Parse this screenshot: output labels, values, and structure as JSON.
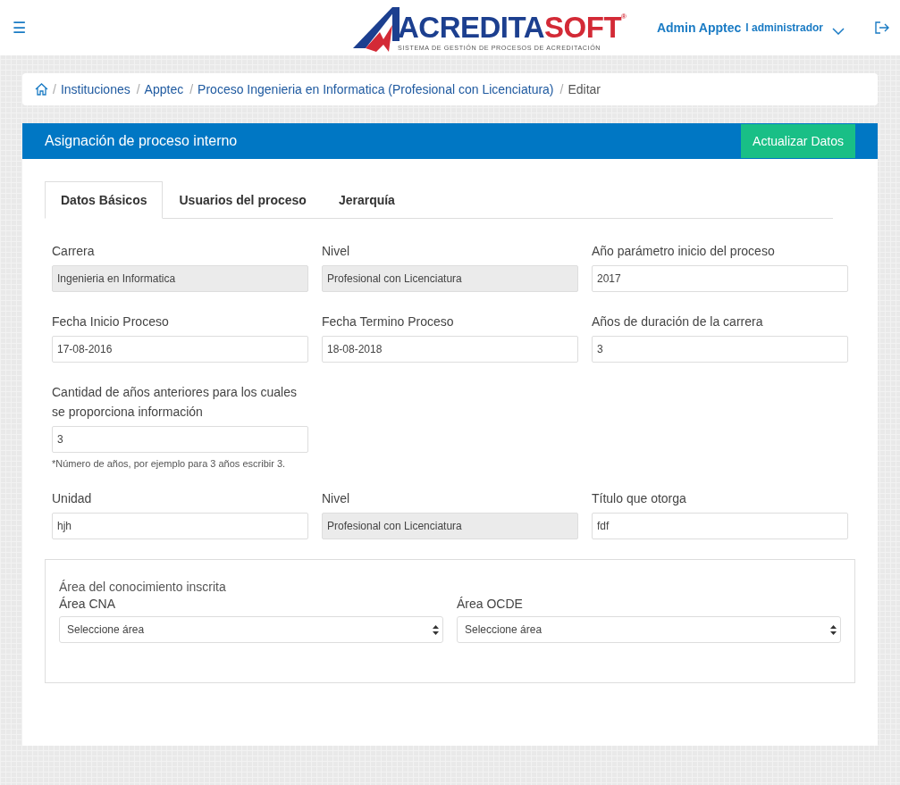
{
  "header": {
    "menu_icon": "☰",
    "logo": {
      "part_1": "ACREDITA",
      "part_2": "SOFT",
      "registered": "®",
      "tagline": "SISTEMA DE GESTIÓN DE PROCESOS DE ACREDITACIÓN"
    },
    "user": {
      "name": "Admin Apptec",
      "role": "l administrador"
    }
  },
  "breadcrumb": [
    {
      "separator": "/",
      "label": "Instituciones",
      "link": true
    },
    {
      "separator": "/",
      "label": "Apptec",
      "link": true
    },
    {
      "separator": "/",
      "label": "Proceso Ingenieria en Informatica (Profesional con Licenciatura)",
      "link": true
    },
    {
      "separator": "/",
      "label": "Editar",
      "link": false
    }
  ],
  "panel": {
    "title": "Asignación de proceso interno",
    "button": "Actualizar Datos"
  },
  "tabs": [
    {
      "label": "Datos Básicos",
      "selected": true
    },
    {
      "label": "Usuarios del proceso",
      "selected": false
    },
    {
      "label": "Jerarquía",
      "selected": false
    }
  ],
  "rows": [
    [
      {
        "label": "Carrera",
        "value": "Ingenieria en Informatica",
        "disabled": true
      },
      {
        "label": "Nivel",
        "value": "Profesional con Licenciatura",
        "disabled": true
      },
      {
        "label": "Año parámetro inicio del proceso",
        "value": "2017",
        "disabled": false
      }
    ],
    [
      {
        "label": "Fecha Inicio Proceso",
        "value": "17-08-2016",
        "disabled": false
      },
      {
        "label": "Fecha Termino Proceso",
        "value": "18-08-2018",
        "disabled": false
      },
      {
        "label": "Años de duración de la carrera",
        "value": "3",
        "disabled": false
      }
    ],
    [
      {
        "label": "Cantidad de años anteriores para los cuales se proporciona información",
        "value": "3",
        "disabled": false,
        "help": "*Número de años, por ejemplo para 3 años escribir 3."
      }
    ],
    [
      {
        "label": "Unidad",
        "value": "hjh",
        "disabled": false
      },
      {
        "label": "Nivel",
        "value": "Profesional con Licenciatura",
        "disabled": true
      },
      {
        "label": "Título que otorga",
        "value": "fdf",
        "disabled": false
      }
    ]
  ],
  "area": {
    "title": "Área del conocimiento inscrita",
    "selects": [
      {
        "label": "Área CNA",
        "placeholder": "Seleccione área"
      },
      {
        "label": "Área OCDE",
        "placeholder": "Seleccione área"
      }
    ]
  }
}
